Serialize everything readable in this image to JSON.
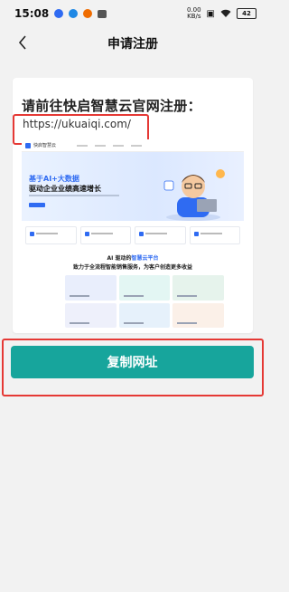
{
  "status_bar": {
    "time": "15:08",
    "net_speed_value": "0.00",
    "net_speed_unit": "KB/s",
    "battery": "42"
  },
  "nav": {
    "title": "申请注册",
    "back_glyph": "‹"
  },
  "card": {
    "heading": "请前往快启智慧云官网注册：",
    "url": "https://ukuaiqi.com/"
  },
  "preview": {
    "logo_text": "快启智慧云",
    "hero_line1": "基于AI+大数据",
    "hero_line2": "驱动企业业绩高速增长",
    "section_title_prefix": "AI 驱动的",
    "section_title_accent": "智慧云平台",
    "section_subtitle": "致力于全流程智能销售服务，为客户创造更多收益"
  },
  "actions": {
    "copy_label": "复制网址"
  },
  "colors": {
    "accent_teal": "#17a59c",
    "highlight_red": "#e53935",
    "brand_blue": "#2f6bf2"
  }
}
